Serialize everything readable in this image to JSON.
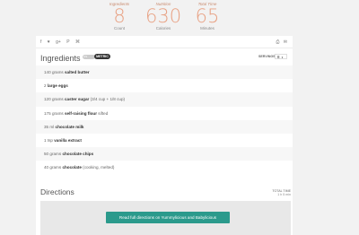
{
  "stats": [
    {
      "label": "Ingredients",
      "value": "8",
      "unit": "Count"
    },
    {
      "label": "Nutrition",
      "value": "630",
      "unit": "Calories"
    },
    {
      "label": "Total Time",
      "value": "65",
      "unit": "Minutes"
    }
  ],
  "share_icons": [
    "facebook-icon",
    "twitter-icon",
    "google-plus-icon",
    "pinterest-icon",
    "reddit-icon"
  ],
  "share_glyphs": [
    "f",
    "♥",
    "g+",
    "P",
    "⌘"
  ],
  "toolbar_glyphs": {
    "print": "⎙",
    "email": "✉"
  },
  "ingredients": {
    "title": "Ingredients",
    "toggle_label": "US",
    "metric_label": "METRIC",
    "servings_label": "SERVINGS",
    "servings_value": "8",
    "items": [
      {
        "qty": "140 grams",
        "name": "salted butter",
        "note": ""
      },
      {
        "qty": "2",
        "name": "large eggs",
        "note": ""
      },
      {
        "qty": "120 grams",
        "name": "caster sugar",
        "note": "(3/4 cup + 1/8 cup)"
      },
      {
        "qty": "175 grams",
        "name": "self-raising flour",
        "note": "sifted"
      },
      {
        "qty": "35 ml",
        "name": "chocolate milk",
        "note": ""
      },
      {
        "qty": "1 tsp",
        "name": "vanilla extract",
        "note": ""
      },
      {
        "qty": "50 grams",
        "name": "chocolate chips",
        "note": ""
      },
      {
        "qty": "40 grams",
        "name": "chocolate",
        "note": "(cooking, melted)"
      }
    ]
  },
  "directions": {
    "title": "Directions",
    "total_time_label": "TOTAL TIME",
    "total_time_value": "1 h 5 min",
    "button_label": "Read full directions on Yummylicious and Babylicious"
  },
  "colors": {
    "accent": "#e8a183",
    "button": "#2b9a8c"
  }
}
